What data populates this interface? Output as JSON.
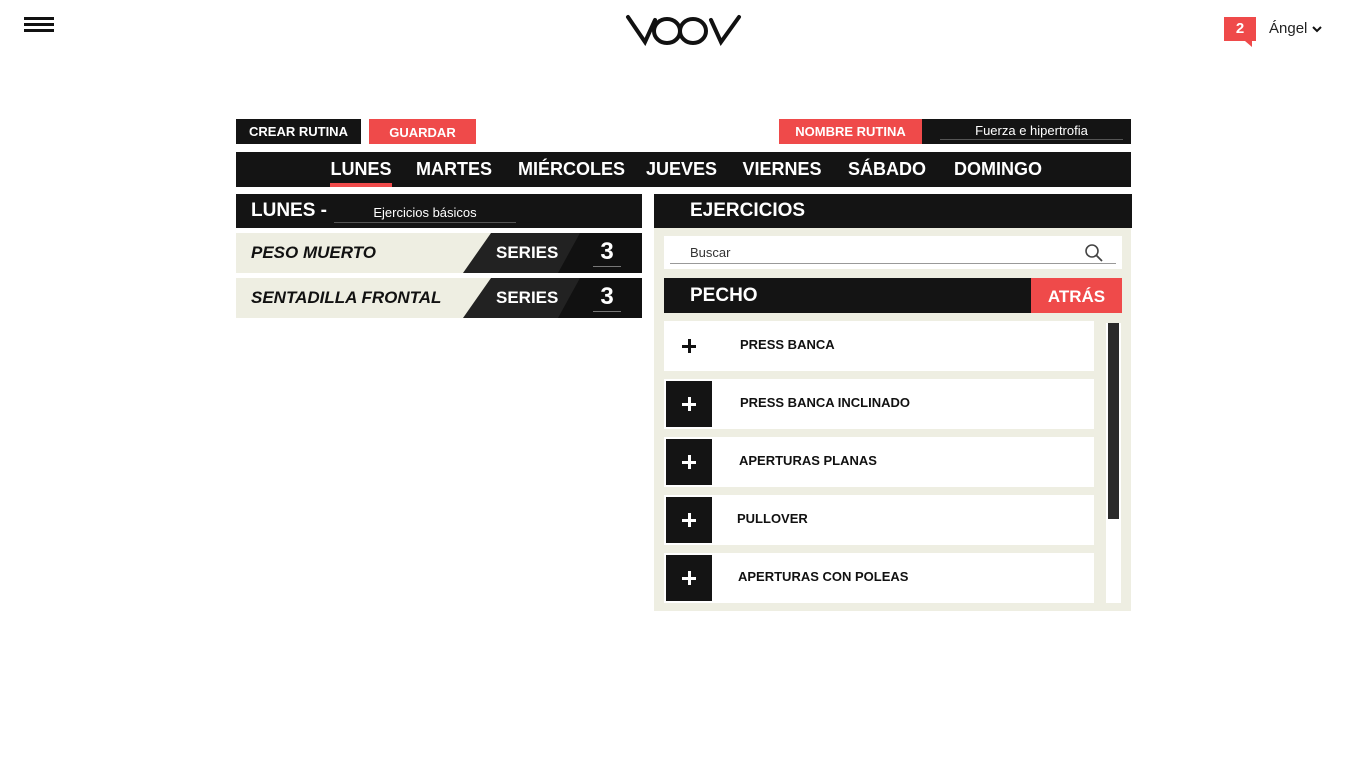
{
  "header": {
    "logo_text": "VOOV",
    "notification_count": "2",
    "user_name": "Ángel"
  },
  "toolbar": {
    "create_label": "CREAR RUTINA",
    "save_label": "GUARDAR",
    "routine_name_label": "NOMBRE RUTINA",
    "routine_name_value": "Fuerza e hipertrofia"
  },
  "days": [
    "LUNES",
    "MARTES",
    "MIÉRCOLES",
    "JUEVES",
    "VIERNES",
    "SÁBADO",
    "DOMINGO"
  ],
  "active_day": "LUNES",
  "day_panel": {
    "title": "LUNES -",
    "description_value": "Ejercicios básicos",
    "series_label": "SERIES",
    "exercises": [
      {
        "name": "PESO MUERTO",
        "series": "3"
      },
      {
        "name": "SENTADILLA FRONTAL",
        "series": "3"
      }
    ]
  },
  "exercises_panel": {
    "title": "EJERCICIOS",
    "search_placeholder": "Buscar",
    "category": "PECHO",
    "back_label": "ATRÁS",
    "items": [
      "PRESS BANCA",
      "PRESS BANCA INCLINADO",
      "APERTURAS PLANAS",
      "PULLOVER",
      "APERTURAS CON POLEAS"
    ]
  },
  "colors": {
    "accent": "#ef4a4a",
    "dark": "#141414",
    "panel_bg": "#eeeee2"
  }
}
